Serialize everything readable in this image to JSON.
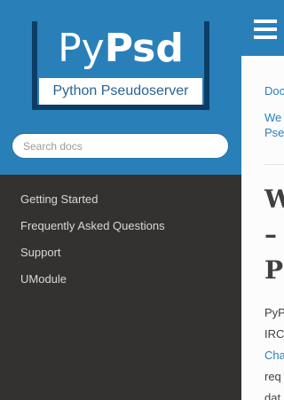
{
  "sidebar": {
    "logo": {
      "title_light": "Py",
      "title_bold": "Psd",
      "subtitle": "Python Pseudoserver"
    },
    "search": {
      "placeholder": "Search docs"
    },
    "nav_items": [
      {
        "label": "Getting Started"
      },
      {
        "label": "Frequently Asked Questions"
      },
      {
        "label": "Support"
      },
      {
        "label": "UModule"
      }
    ]
  },
  "content": {
    "breadcrumb_home": "Doc",
    "breadcrumb_page": "We\nPse",
    "heading": "W\n–\nPs",
    "paragraph": {
      "l1": "PyP",
      "l2": "IRC",
      "l3_link": "Cha",
      "l4": "req",
      "l5": "dat"
    }
  },
  "colors": {
    "accent": "#2980b9",
    "sidebar_bg": "#343131",
    "text": "#404040"
  }
}
